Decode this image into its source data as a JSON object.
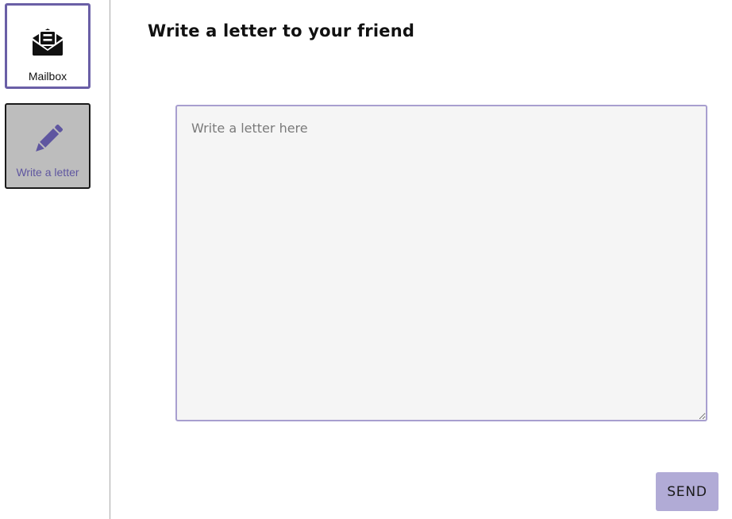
{
  "sidebar": {
    "items": [
      {
        "label": "Mailbox",
        "icon": "envelope-open-icon"
      },
      {
        "label": "Write a letter",
        "icon": "pencil-icon"
      }
    ]
  },
  "main": {
    "title": "Write a letter to your friend",
    "letter_placeholder": "Write a letter here",
    "letter_value": "",
    "send_label": "SEND"
  },
  "colors": {
    "accent": "#6a5fa6",
    "send_bg": "#b1abd6",
    "textarea_bg": "#f5f5f5",
    "active_tile_bg": "#bdbdbd"
  }
}
